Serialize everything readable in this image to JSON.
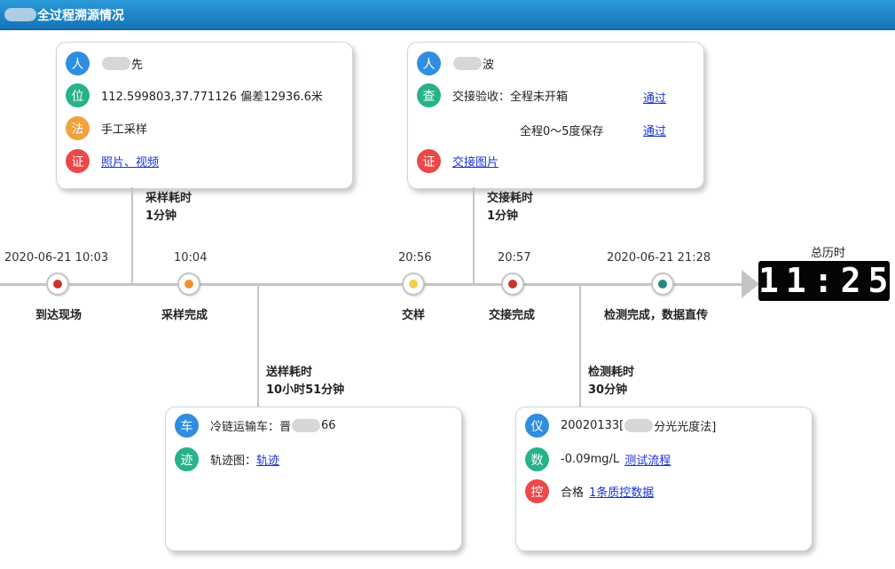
{
  "header": {
    "title": "全过程溯源情况"
  },
  "timeline": {
    "events": [
      {
        "time": "2020-06-21 10:03",
        "label": "到达现场",
        "color": "#c8372d"
      },
      {
        "time": "10:04",
        "label": "采样完成",
        "color": "#f0902e"
      },
      {
        "time": "20:56",
        "label": "交样",
        "color": "#f2cf4a"
      },
      {
        "time": "20:57",
        "label": "交接完成",
        "color": "#c8372d"
      },
      {
        "time": "2020-06-21 21:28",
        "label": "检测完成，数据直传",
        "color": "#238a7a"
      }
    ],
    "durations": {
      "sampling": {
        "title": "采样耗时",
        "value": "1分钟"
      },
      "handover": {
        "title": "交接耗时",
        "value": "1分钟"
      },
      "transport": {
        "title": "送样耗时",
        "value": "10小时51分钟"
      },
      "testing": {
        "title": "检测耗时",
        "value": "30分钟"
      }
    },
    "total": {
      "label": "总历时",
      "value": "11:25"
    }
  },
  "sampling_card": {
    "person": {
      "icon": "人",
      "name_suffix": "先"
    },
    "location": {
      "icon": "位",
      "text": "112.599803,37.771126 偏差12936.6米"
    },
    "method": {
      "icon": "法",
      "text": "手工采样"
    },
    "evidence": {
      "icon": "证",
      "link": "照片、视频"
    }
  },
  "handover_card": {
    "person": {
      "icon": "人",
      "name_suffix": "波"
    },
    "check": {
      "icon": "查",
      "label": "交接验收：",
      "item1": "全程未开箱",
      "result1": "通过",
      "item2": "全程0～5度保存",
      "result2": "通过"
    },
    "evidence": {
      "icon": "证",
      "link": "交接图片"
    }
  },
  "transport_card": {
    "vehicle": {
      "icon": "车",
      "text_prefix": "冷链运输车：晋",
      "text_suffix": "66"
    },
    "track": {
      "icon": "迹",
      "label": "轨迹图：",
      "link": "轨迹"
    }
  },
  "testing_card": {
    "instrument": {
      "icon": "仪",
      "text_prefix": "20020133[",
      "text_suffix": "分光光度法]"
    },
    "data": {
      "icon": "数",
      "value": "-0.09mg/L",
      "link": "测试流程"
    },
    "control": {
      "icon": "控",
      "label": "合格",
      "link": "1条质控数据"
    }
  }
}
